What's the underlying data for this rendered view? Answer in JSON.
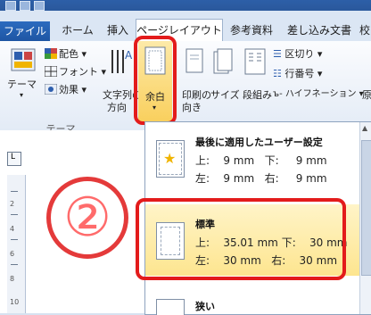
{
  "tabs": [
    "ファイル",
    "ホーム",
    "挿入",
    "ページレイアウト",
    "参考資料",
    "差し込み文書",
    "校"
  ],
  "ribbon": {
    "theme_label": "テーマ",
    "colors_label": "配色",
    "fonts_label": "フォント",
    "effects_label": "効果",
    "text_direction_label": "文字列の",
    "text_direction_label2": "方向",
    "margins_label": "余白",
    "orientation_label": "印刷の",
    "orientation_label2": "向き",
    "size_label": "サイズ",
    "columns_label": "段組み",
    "breaks_label": "区切り",
    "line_numbers_label": "行番号",
    "hyphenation_label": "ハイフネーション",
    "group_theme_label": "テーマ",
    "partial_label": "原"
  },
  "annotation_number": "②",
  "ruler_numbers": [
    "L",
    "2",
    "4",
    "6",
    "8",
    "10"
  ],
  "dropdown": {
    "items": [
      {
        "title": "最後に適用したユーザー設定",
        "top_label": "上:",
        "top_value": "9 mm",
        "bottom_label": "下:",
        "bottom_value": "9 mm",
        "left_label": "左:",
        "left_value": "9 mm",
        "right_label": "右:",
        "right_value": "9 mm"
      },
      {
        "title": "標準",
        "top_label": "上:",
        "top_value": "35.01 mm",
        "bottom_label": "下:",
        "bottom_value": "30 mm",
        "left_label": "左:",
        "left_value": "30 mm",
        "right_label": "右:",
        "right_value": "30 mm"
      },
      {
        "title": "狭い"
      }
    ]
  },
  "colors": {
    "accent_red": "#e31b1b",
    "hover_yellow": "#fde58f",
    "file_tab_blue": "#2563b1"
  }
}
